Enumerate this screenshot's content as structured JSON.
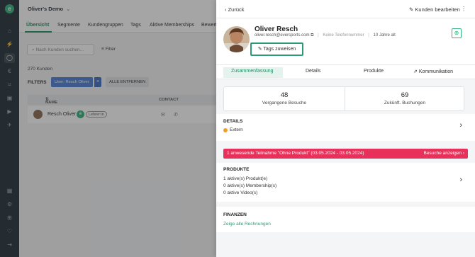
{
  "workspace": {
    "name": "Oliver's Demo"
  },
  "sidebar": {
    "icons": [
      "logo-icon",
      "home-icon",
      "bolt-icon",
      "user-icon",
      "euro-icon",
      "chart-icon",
      "box-icon",
      "play-icon",
      "rocket-icon",
      "calendar-icon",
      "settings-icon",
      "plus-square-icon",
      "heart-icon",
      "logout-icon"
    ]
  },
  "tabs": [
    "Übersicht",
    "Segmente",
    "Kundengruppen",
    "Tags",
    "Aktive Memberships",
    "Bewert"
  ],
  "search": {
    "placeholder": "Nach Kunden suchen..."
  },
  "filter_label": "Filter",
  "customer_count": "270 Kunden",
  "filters": {
    "label": "FILTERS",
    "chip": "User: Resch Oliver",
    "chip_close": "×",
    "clear": "ALLE ENTFERNEN"
  },
  "table": {
    "headers": [
      "NAME",
      "CONTACT"
    ],
    "rows": [
      {
        "name": "Resch Oliver",
        "badge": "Lehrer:in"
      }
    ]
  },
  "drawer": {
    "back": "Zurück",
    "edit": "Kunden bearbeiten",
    "name": "Oliver Resch",
    "email": "oliver.resch@eversports.com",
    "phone": "Keine Telefonnummer",
    "age": "10 Jahre alt",
    "tags_button": "Tags zuweisen",
    "tabs": [
      "Zusammenfassung",
      "Details",
      "Produkte",
      "Kommunikation"
    ],
    "stats": [
      {
        "value": "48",
        "label": "Vergangene Besuche"
      },
      {
        "value": "69",
        "label": "Zukünft. Buchungen"
      }
    ],
    "details": {
      "title": "DETAILS",
      "status": "Extern",
      "status_color": "#f0a020"
    },
    "alert": {
      "text": "1 anwesende Teilnahme \"Ohne Produkt\" (03.05.2024 - 03.05.2024)",
      "action": "Besuche anzeigen",
      "color": "#e8315a"
    },
    "products": {
      "title": "PRODUKTE",
      "lines": [
        "1 aktive(s) Produkt(e)",
        "0 aktive(s) Membership(s)",
        "0 aktive Video(s)"
      ]
    },
    "finance": {
      "title": "FINANZEN",
      "link": "Zeige alle Rechnungen"
    }
  },
  "colors": {
    "accent": "#2c9b76",
    "sidebar": "#243037"
  }
}
